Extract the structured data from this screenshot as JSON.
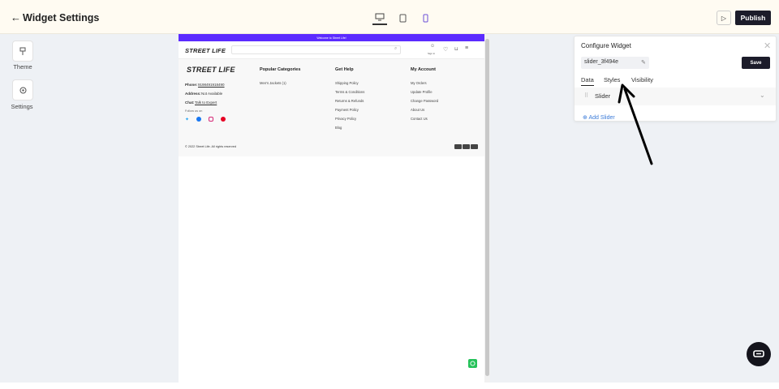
{
  "header": {
    "title": "Widget Settings",
    "publish_label": "Publish"
  },
  "left_tools": [
    {
      "label": "Theme"
    },
    {
      "label": "Settings"
    }
  ],
  "preview": {
    "announcement": "Welcome to Street Life!",
    "logo": "STREET LIFE",
    "account_label": "Sign in",
    "footer": {
      "logo": "STREET LIFE",
      "phone_label": "Phone:",
      "phone_value": "9198491918490",
      "address_label": "Address:",
      "address_value": "Not Available",
      "chat_label": "Chat:",
      "chat_value": "Talk to Expert",
      "follow": "Follow us on",
      "columns": [
        {
          "heading": "Popular Categories",
          "links": [
            "Men's Jackets (1)"
          ]
        },
        {
          "heading": "Get Help",
          "links": [
            "Shipping Policy",
            "Terms & Conditions",
            "Returns & Refunds",
            "Payment Policy",
            "Privacy Policy",
            "Blog"
          ]
        },
        {
          "heading": "My Account",
          "links": [
            "My Orders",
            "Update Profile",
            "Change Password",
            "About Us",
            "Contact Us"
          ]
        }
      ],
      "copyright": "© 2022 Street Life. All rights reserved"
    }
  },
  "panel": {
    "title": "Configure Widget",
    "widget_id": "slider_3f494e",
    "save_label": "Save",
    "tabs": [
      "Data",
      "Styles",
      "Visibility"
    ],
    "item_label": "Slider",
    "add_label": "Add Slider"
  },
  "colors": {
    "accent": "#5b2bff",
    "dark": "#1c1c2a",
    "link": "#3b7bd8"
  }
}
